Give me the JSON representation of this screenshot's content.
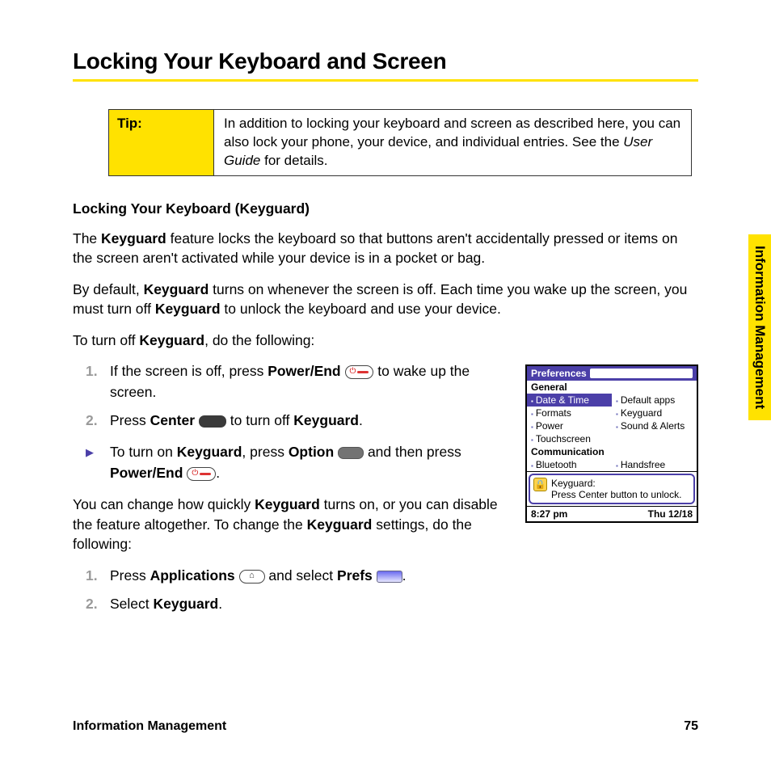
{
  "heading": "Locking Your Keyboard and Screen",
  "tip": {
    "label": "Tip:",
    "body_before": "In addition to locking your keyboard and screen as described here, you can also lock your phone, your device, and individual entries. See the ",
    "body_em": "User Guide",
    "body_after": " for details."
  },
  "subhead": "Locking Your Keyboard (Keyguard)",
  "para1": {
    "pre": "The ",
    "b1": "Keyguard",
    "post": " feature locks the keyboard so that buttons aren't accidentally pressed or items on the screen aren't activated while your device is in a pocket or bag."
  },
  "para2": {
    "pre": "By default, ",
    "b1": "Keyguard",
    "mid": " turns on whenever the screen is off. Each time you wake up the screen, you must turn off ",
    "b2": "Keyguard",
    "post": " to unlock the keyboard and use your device."
  },
  "para3": {
    "pre": "To turn off ",
    "b1": "Keyguard",
    "post": ", do the following:"
  },
  "steps1": {
    "s1": {
      "num": "1.",
      "pre": "If the screen is off, press ",
      "b1": "Power/End",
      "post": " to wake up the screen."
    },
    "s2": {
      "num": "2.",
      "pre": "Press ",
      "b1": "Center",
      "mid": " to turn off ",
      "b2": "Keyguard",
      "post": "."
    }
  },
  "bullet1": {
    "pre": "To turn on ",
    "b1": "Keyguard",
    "mid": ", press ",
    "b2": "Option",
    "mid2": " and then press ",
    "b3": "Power/End",
    "post": "."
  },
  "para4": {
    "pre": "You can change how quickly ",
    "b1": "Keyguard",
    "mid": " turns on, or you can disable the feature altogether. To change the ",
    "b2": "Keyguard",
    "post": " settings, do the following:"
  },
  "steps2": {
    "s1": {
      "num": "1.",
      "pre": "Press ",
      "b1": "Applications",
      "mid": " and select ",
      "b2": "Prefs",
      "post": "."
    },
    "s2": {
      "num": "2.",
      "pre": "Select ",
      "b1": "Keyguard",
      "post": "."
    }
  },
  "device": {
    "title": "Preferences",
    "section_general": "General",
    "items_general_left": [
      "Date & Time",
      "Formats",
      "Power",
      "Touchscreen"
    ],
    "items_general_right": [
      "Default apps",
      "Keyguard",
      "Sound & Alerts"
    ],
    "section_comm": "Communication",
    "items_comm_left": [
      "Bluetooth"
    ],
    "items_comm_right": [
      "Handsfree"
    ],
    "lock_title": "Keyguard:",
    "lock_msg": "Press Center button to unlock.",
    "time": "8:27 pm",
    "date": "Thu 12/18"
  },
  "side_tab": "Information Management",
  "footer_left": "Information Management",
  "footer_right": "75"
}
